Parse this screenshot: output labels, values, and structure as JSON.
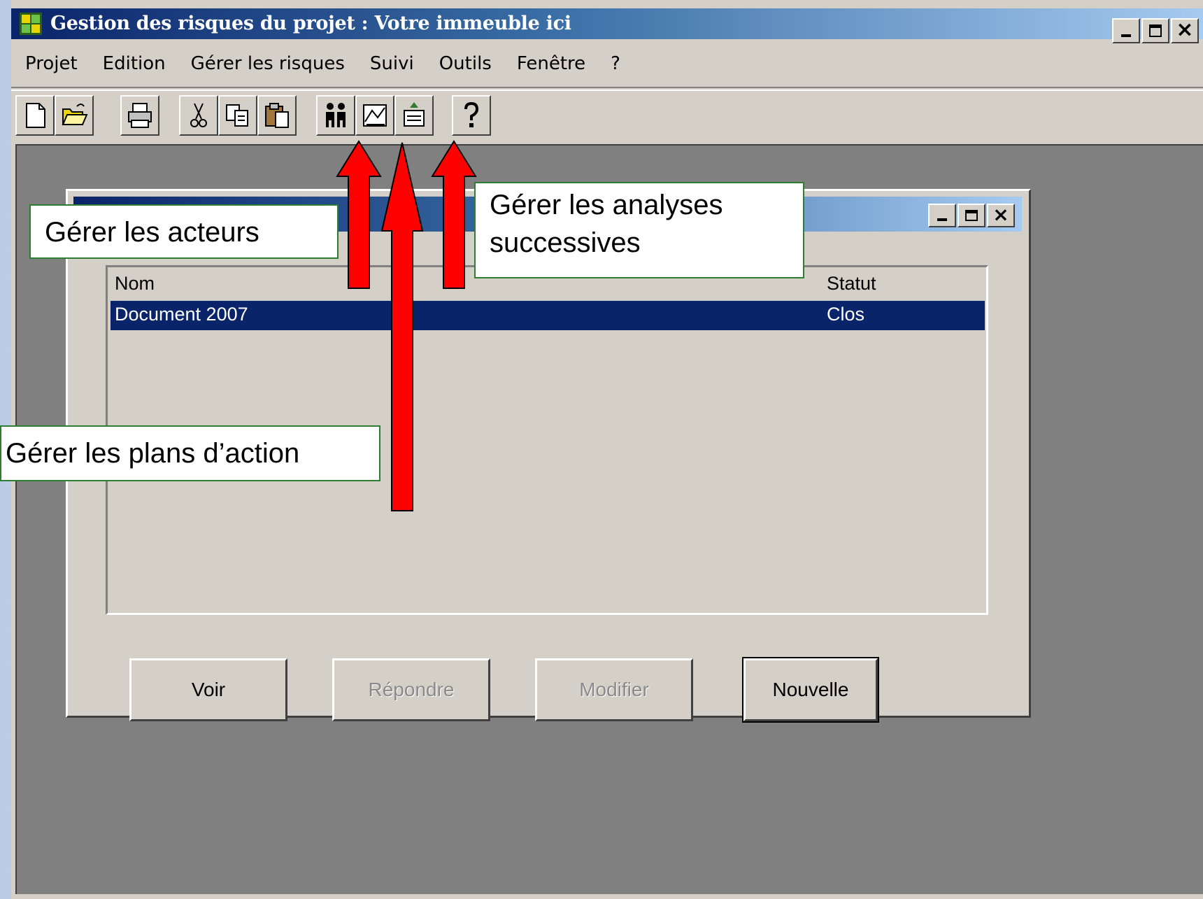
{
  "window": {
    "title": "Gestion des risques du projet : Votre immeuble ici",
    "icon": "app-icon"
  },
  "menu": {
    "items": [
      "Projet",
      "Edition",
      "Gérer les risques",
      "Suivi",
      "Outils",
      "Fenêtre",
      "?"
    ]
  },
  "toolbar": {
    "buttons": [
      "new-document-icon",
      "open-folder-icon",
      "print-icon",
      "cut-icon",
      "copy-icon",
      "paste-icon",
      "actors-icon",
      "action-plans-icon",
      "successive-analyses-icon",
      "help-icon"
    ]
  },
  "child_window": {
    "list": {
      "columns": {
        "name": "Nom",
        "status": "Statut"
      },
      "rows": [
        {
          "name": "Document 2007",
          "status": "Clos",
          "selected": true
        }
      ]
    },
    "buttons": {
      "view": "Voir",
      "reply": "Répondre",
      "modify": "Modifier",
      "new": "Nouvelle"
    }
  },
  "callouts": {
    "actors": "Gérer les acteurs",
    "analyses_line1": "Gérer les analyses",
    "analyses_line2": "successives",
    "action_plans": "Gérer les plans d’action"
  },
  "colors": {
    "titlebar_start": "#0a246a",
    "titlebar_end": "#a6caf0",
    "window_face": "#d4d0c8",
    "mdi_background": "#808080",
    "selection": "#0a246a",
    "arrow": "#ff0000",
    "callout_border": "#2e7d32"
  }
}
